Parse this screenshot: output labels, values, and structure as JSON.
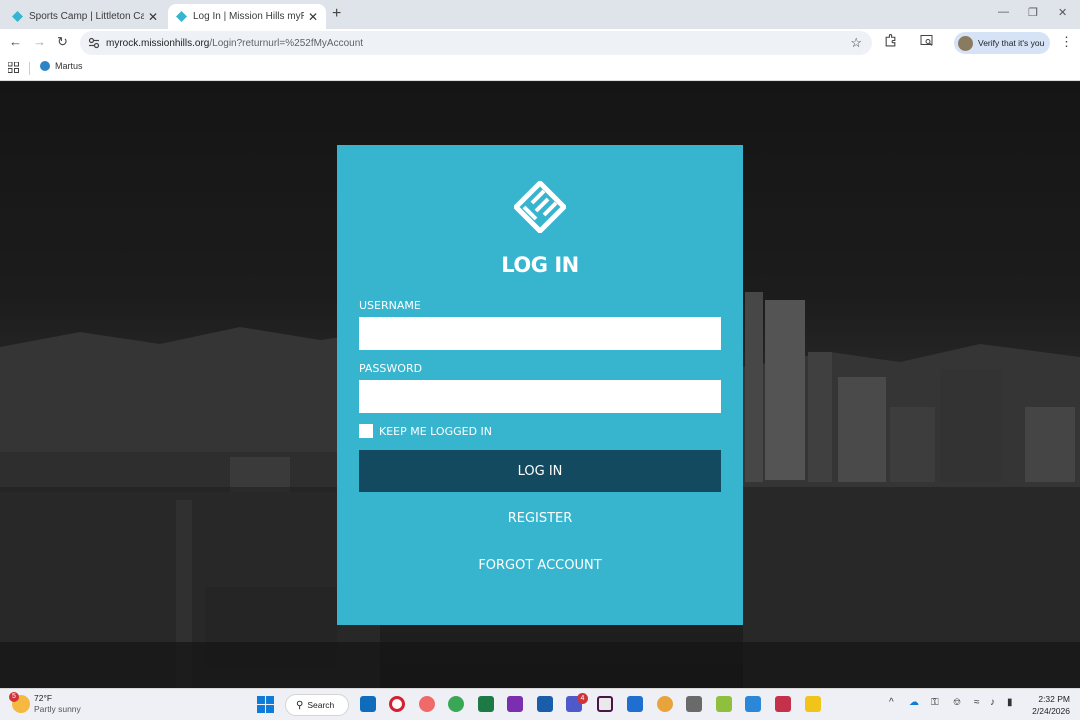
{
  "browser": {
    "tabs": [
      {
        "title": "Sports Camp | Littleton Campus",
        "close": "✕"
      },
      {
        "title": "Log In | Mission Hills myRock",
        "close": "✕"
      }
    ],
    "new_tab": "+",
    "window_controls": {
      "minimize": "—",
      "maximize": "❐",
      "close": "✕"
    },
    "nav": {
      "back": "←",
      "forward": "→",
      "reload": "↻"
    },
    "url_host": "myrock.missionhills.org",
    "url_path": "/Login?returnurl=%252fMyAccount",
    "star": "☆",
    "verify_label": "Verify that it's you",
    "menu": "⋮",
    "bookmarks": [
      {
        "label": "Martus"
      }
    ]
  },
  "login": {
    "title": "LOG IN",
    "username_label": "USERNAME",
    "username_value": "",
    "password_label": "PASSWORD",
    "password_value": "",
    "keep_logged_in_label": "KEEP ME LOGGED IN",
    "keep_logged_in_checked": false,
    "login_button": "LOG IN",
    "register_link": "REGISTER",
    "forgot_link": "FORGOT ACCOUNT"
  },
  "taskbar": {
    "weather": {
      "badge": "5",
      "temp": "72°F",
      "condition": "Partly sunny"
    },
    "search_label": "Search",
    "teams_badge": "4",
    "time": "2:32 PM",
    "date": "2/24/2026"
  },
  "colors": {
    "card": "#37b5cf",
    "button": "#134a60"
  }
}
